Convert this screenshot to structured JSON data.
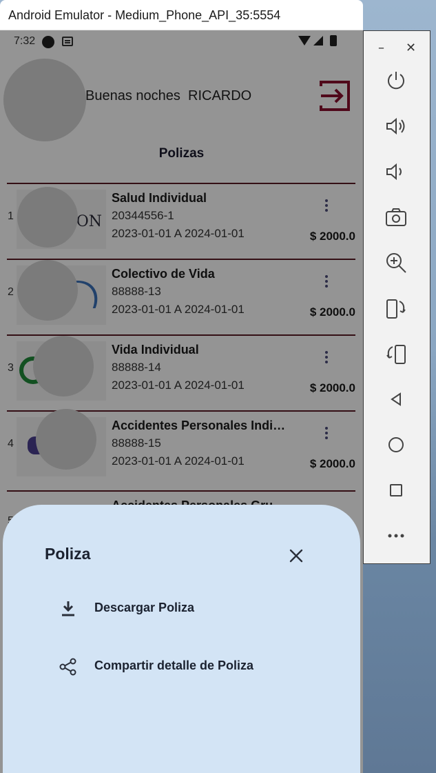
{
  "window": {
    "title": "Android Emulator - Medium_Phone_API_35:5554"
  },
  "status_bar": {
    "time": "7:32"
  },
  "header": {
    "greeting": "Buenas noches  RICARDO",
    "logout_icon": "logout-icon"
  },
  "section_title": "Polizas",
  "policies": [
    {
      "index": "1",
      "name": "Salud Individual",
      "code": "20344556-1",
      "dates": "2023-01-01 A 2024-01-01",
      "amount": "$ 2000.0",
      "logo_text": "ON"
    },
    {
      "index": "2",
      "name": "Colectivo de Vida",
      "code": "88888-13",
      "dates": "2023-01-01 A 2024-01-01",
      "amount": "$ 2000.0"
    },
    {
      "index": "3",
      "name": "Vida Individual",
      "code": "88888-14",
      "dates": "2023-01-01 A 2024-01-01",
      "amount": "$ 2000.0"
    },
    {
      "index": "4",
      "name": "Accidentes Personales Indi…",
      "code": "88888-15",
      "dates": "2023-01-01 A 2024-01-01",
      "amount": "$ 2000.0"
    },
    {
      "index": "5",
      "name": "Accidentes Personales Gru…"
    }
  ],
  "bottom_sheet": {
    "title": "Poliza",
    "items": [
      {
        "label": "Descargar Poliza",
        "icon": "download-icon"
      },
      {
        "label": "Compartir detalle de Poliza",
        "icon": "share-icon"
      }
    ]
  },
  "emulator_toolbar": {
    "buttons": [
      "power-icon",
      "volume-up-icon",
      "volume-down-icon",
      "camera-icon",
      "zoom-icon",
      "rotate-left-icon",
      "rotate-right-icon",
      "back-icon",
      "home-icon",
      "overview-icon",
      "more-icon"
    ]
  },
  "colors": {
    "accent": "#8a1030",
    "sheet": "#d3e4f5",
    "divider": "#5a1a25"
  }
}
